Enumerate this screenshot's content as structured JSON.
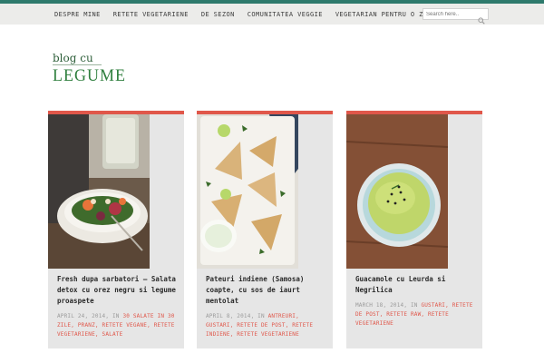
{
  "nav": {
    "items": [
      "DESPRE MINE",
      "RETETE VEGETARIENE",
      "DE SEZON",
      "COMUNITATEA VEGGIE",
      "VEGETARIAN PENTRU O ZI"
    ]
  },
  "search": {
    "placeholder": "Search here.."
  },
  "logo": {
    "line1": "blog cu",
    "line2": "LEGUME"
  },
  "colors": {
    "accent": "#e0574a",
    "top_border": "#2e7a6c",
    "card_bg": "#e6e6e6"
  },
  "posts": [
    {
      "title": "Fresh dupa sarbatori – Salata detox cu orez negru si legume proaspete",
      "date": "APRIL 24, 2014",
      "in": ", IN",
      "categories": "30 SALATE IN 30 ZILE, PRANZ, RETETE VEGANE, RETETE VEGETARIENE, SALATE"
    },
    {
      "title": "Pateuri indiene (Samosa) coapte, cu sos de iaurt mentolat",
      "date": "APRIL 8, 2014",
      "in": ", IN",
      "categories": "ANTREURI, GUSTARI, RETETE DE POST, RETETE INDIENE, RETETE VEGETARIENE"
    },
    {
      "title": "Guacamole cu Leurda si Negrilica",
      "date": "MARCH 18, 2014",
      "in": ", IN",
      "categories": "GUSTARI, RETETE DE POST, RETETE RAW, RETETE VEGETARIENE"
    }
  ]
}
